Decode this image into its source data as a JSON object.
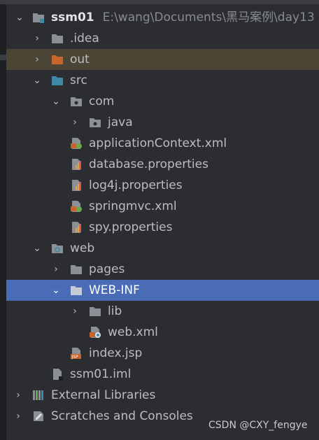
{
  "project": {
    "name": "ssm01",
    "path": "E:\\wang\\Documents\\黑马案例\\day13"
  },
  "tree": {
    "idea": ".idea",
    "out": "out",
    "src": "src",
    "com": "com",
    "java": "java",
    "app_ctx": "applicationContext.xml",
    "db_props": "database.properties",
    "log4j": "log4j.properties",
    "springmvc": "springmvc.xml",
    "spy": "spy.properties",
    "web": "web",
    "pages": "pages",
    "webinf": "WEB-INF",
    "lib": "lib",
    "webxml": "web.xml",
    "indexjsp": "index.jsp",
    "iml": "ssm01.iml",
    "ext_libs": "External Libraries",
    "scratches": "Scratches and Consoles"
  },
  "watermark": "CSDN @CXY_fengye",
  "colors": {
    "background": "#2b2d30",
    "selection": "#4a6bb5",
    "excluded_highlight": "#4b4536",
    "folder": "#8b9096",
    "source_folder": "#3d89a8",
    "excluded_folder": "#c8652c"
  }
}
